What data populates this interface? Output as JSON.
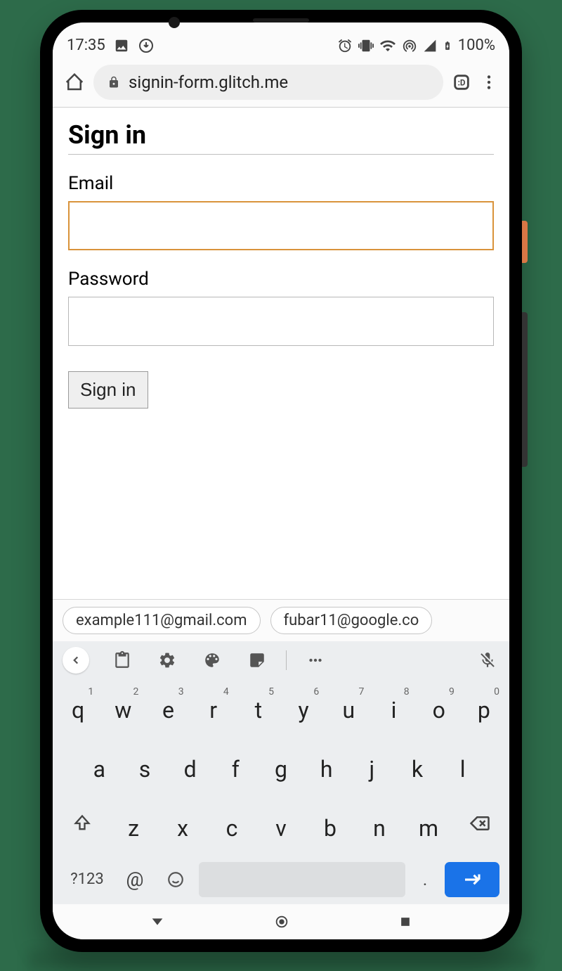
{
  "status": {
    "time": "17:35",
    "battery": "100%"
  },
  "browser": {
    "url": "signin-form.glitch.me"
  },
  "page": {
    "title": "Sign in",
    "email_label": "Email",
    "password_label": "Password",
    "submit_label": "Sign in"
  },
  "suggestions": [
    "example111@gmail.com",
    "fubar11@google.co"
  ],
  "keyboard": {
    "row1": [
      {
        "k": "q",
        "n": "1"
      },
      {
        "k": "w",
        "n": "2"
      },
      {
        "k": "e",
        "n": "3"
      },
      {
        "k": "r",
        "n": "4"
      },
      {
        "k": "t",
        "n": "5"
      },
      {
        "k": "y",
        "n": "6"
      },
      {
        "k": "u",
        "n": "7"
      },
      {
        "k": "i",
        "n": "8"
      },
      {
        "k": "o",
        "n": "9"
      },
      {
        "k": "p",
        "n": "0"
      }
    ],
    "row2": [
      "a",
      "s",
      "d",
      "f",
      "g",
      "h",
      "j",
      "k",
      "l"
    ],
    "row3": [
      "z",
      "x",
      "c",
      "v",
      "b",
      "n",
      "m"
    ],
    "sym": "?123",
    "at": "@",
    "period": "."
  }
}
